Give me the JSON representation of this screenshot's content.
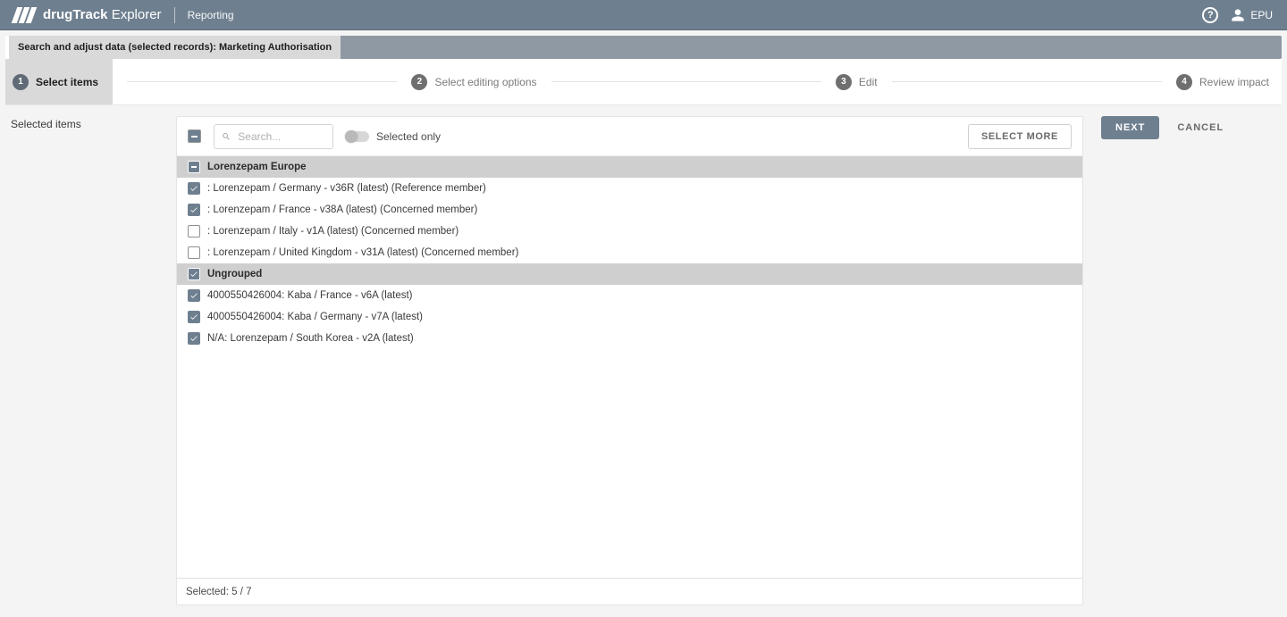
{
  "header": {
    "app_name_bold": "drugTrack",
    "app_name_light": " Explorer",
    "nav": "Reporting",
    "user": "EPU"
  },
  "sub_header": {
    "active_tab": "Search and adjust data (selected records): Marketing Authorisation"
  },
  "steps": [
    {
      "num": "1",
      "label": "Select items"
    },
    {
      "num": "2",
      "label": "Select editing options"
    },
    {
      "num": "3",
      "label": "Edit"
    },
    {
      "num": "4",
      "label": "Review impact"
    }
  ],
  "left_label": "Selected items",
  "toolbar": {
    "search_placeholder": "Search...",
    "switch_label": "Selected only",
    "select_more": "SELECT MORE"
  },
  "groups": [
    {
      "title": "Lorenzepam Europe",
      "state": "indeterminate",
      "items": [
        {
          "checked": true,
          "text": ": Lorenzepam / Germany - v36R (latest) (Reference member)"
        },
        {
          "checked": true,
          "text": ": Lorenzepam / France - v38A (latest) (Concerned member)"
        },
        {
          "checked": false,
          "text": ": Lorenzepam / Italy - v1A (latest) (Concerned member)"
        },
        {
          "checked": false,
          "text": ": Lorenzepam / United Kingdom - v31A (latest) (Concerned member)"
        }
      ]
    },
    {
      "title": "Ungrouped",
      "state": "checked",
      "items": [
        {
          "checked": true,
          "text": "4000550426004: Kaba / France - v6A (latest)"
        },
        {
          "checked": true,
          "text": "4000550426004: Kaba / Germany - v7A (latest)"
        },
        {
          "checked": true,
          "text": "N/A: Lorenzepam / South Korea - v2A (latest)"
        }
      ]
    }
  ],
  "footer": "Selected: 5 / 7",
  "actions": {
    "next": "NEXT",
    "cancel": "CANCEL"
  }
}
